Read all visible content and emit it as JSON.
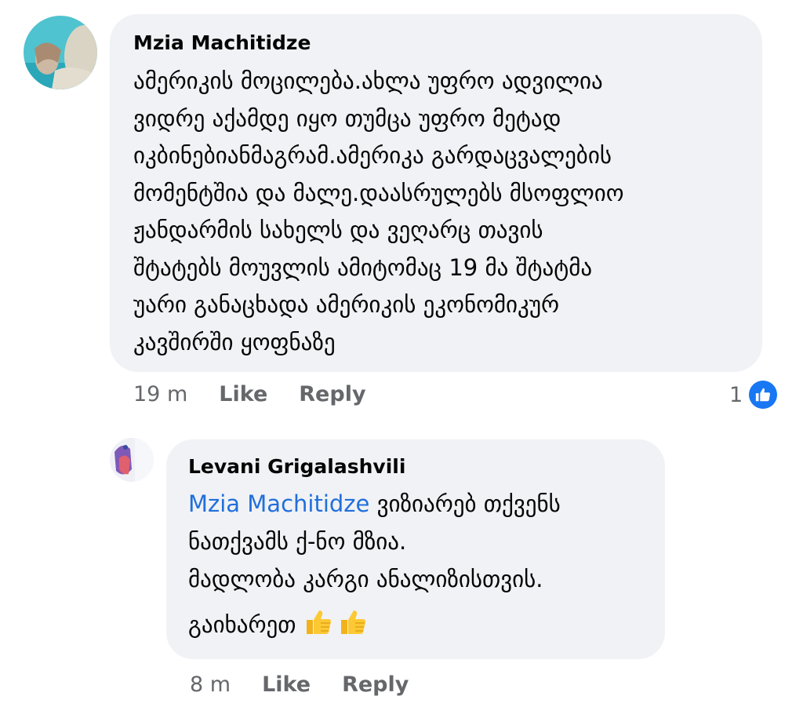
{
  "comments": [
    {
      "author": "Mzia Machitidze",
      "lines": [
        "ამერიკის მოცილება.ახლა უფრო ადვილია",
        "ვიდრე აქამდე იყო თუმცა უფრო მეტად",
        "იკბინებიანმაგრამ.ამერიკა გარდაცვალების",
        "მომენტშია და მალე.დაასრულებს მსოფლიო",
        "ჟანდარმის სახელს და ვეღარც თავის",
        "შტატებს მოუვლის ამიტომაც 19 მა შტატმა",
        "უარი განაცხადა ამერიკის ეკონომიკურ",
        "კავშირში ყოფნაზე"
      ],
      "time": "19 m",
      "like_label": "Like",
      "reply_label": "Reply",
      "reaction_count": "1",
      "reaction_icon": "like-thumb-icon",
      "reaction_color": "#1877f2"
    },
    {
      "author": "Levani Grigalashvili",
      "mention": "Mzia Machitidze",
      "line1_rest": " ვიზიარებ თქვენს",
      "line2": "ნათქვამს ქ-ნო მზია.",
      "line3": "მადლობა კარგი ანალიზისთვის.",
      "line4": "გაიხარეთ",
      "emoji": "thumbs-up-emoji",
      "time": "8 m",
      "like_label": "Like",
      "reply_label": "Reply"
    }
  ],
  "colors": {
    "bubble": "#f0f2f5",
    "meta": "#65676b",
    "mention": "#216fdb"
  }
}
